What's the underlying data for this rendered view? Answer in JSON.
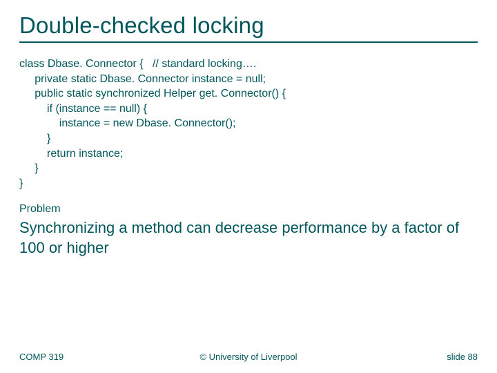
{
  "title": "Double-checked locking",
  "code": "class Dbase. Connector {   // standard locking….\n     private static Dbase. Connector instance = null;\n     public static synchronized Helper get. Connector() {\n         if (instance == null) {\n             instance = new Dbase. Connector();\n         }\n         return instance;\n     }\n}",
  "problem_label": "Problem",
  "problem_body": "Synchronizing a method can decrease performance by a factor of 100 or higher",
  "footer": {
    "left": "COMP 319",
    "center": "© University of Liverpool",
    "right": "slide  88"
  }
}
